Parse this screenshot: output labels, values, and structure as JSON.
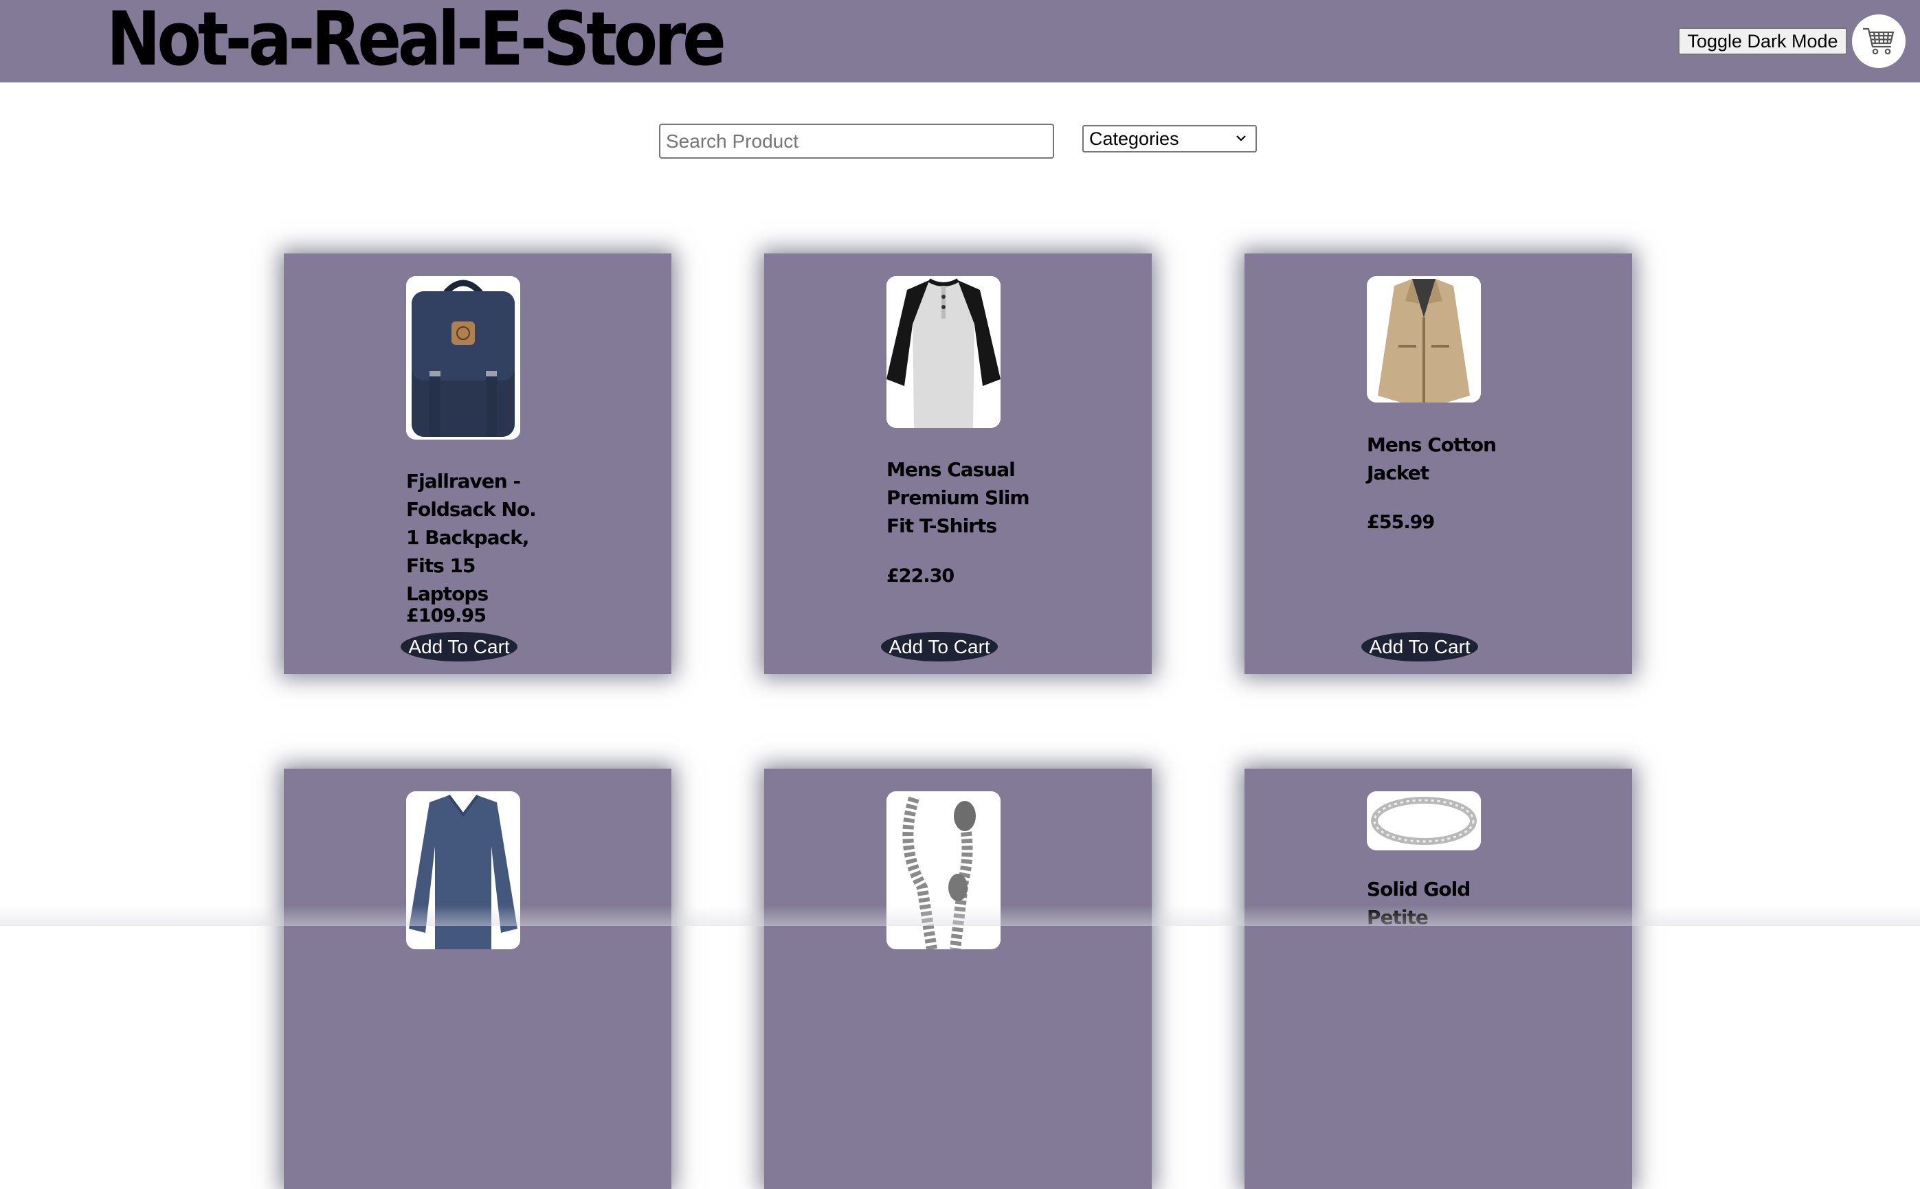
{
  "header": {
    "logo": "Not-a-Real-E-Store",
    "toggle_label": "Toggle Dark Mode",
    "cart_icon": "shopping-cart-icon"
  },
  "search": {
    "placeholder": "Search Product",
    "value": ""
  },
  "categories": {
    "selected": "Categories"
  },
  "colors": {
    "header_bg": "#827a96",
    "card_bg": "#827a96",
    "button_bg": "#1e2235",
    "page_bg": "#ffffff"
  },
  "products": [
    {
      "title": "Fjallraven - Foldsack No. 1 Backpack, Fits 15 Laptops",
      "price": "£109.95",
      "button": "Add To Cart",
      "image": "backpack"
    },
    {
      "title": "Mens Casual Premium Slim Fit T-Shirts",
      "price": "£22.30",
      "button": "Add To Cart",
      "image": "raglan-t-shirt"
    },
    {
      "title": "Mens Cotton Jacket",
      "price": "£55.99",
      "button": "Add To Cart",
      "image": "cotton-jacket"
    },
    {
      "title": "",
      "price": "",
      "button": "",
      "image": "long-sleeve-shirt"
    },
    {
      "title": "",
      "price": "",
      "button": "",
      "image": "dragon-chain-bracelet"
    },
    {
      "title": "Solid Gold Petite",
      "price": "",
      "button": "",
      "image": "silver-ring"
    }
  ]
}
